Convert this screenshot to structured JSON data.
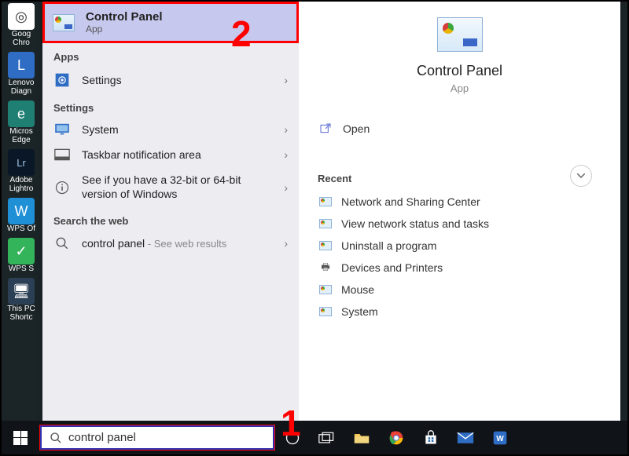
{
  "desktop": {
    "icons": [
      {
        "label": "Goog\nChro",
        "color": "#ffffff"
      },
      {
        "label": "Lenovo\nDiagn",
        "color": "#2f6dc4"
      },
      {
        "label": "Micros\nEdge",
        "color": "#1f7f73"
      },
      {
        "label": "Adobe\nLightro",
        "color": "#0a1726"
      },
      {
        "label": "WPS Of",
        "color": "#1f8fd6"
      },
      {
        "label": "WPS S",
        "color": "#33b35a"
      },
      {
        "label": "This PC\nShortc",
        "color": "#2b3f55"
      }
    ]
  },
  "best_match": {
    "title": "Control Panel",
    "subtitle": "App"
  },
  "sections": {
    "apps_head": "Apps",
    "apps": [
      {
        "icon": "gear",
        "label": "Settings"
      }
    ],
    "settings_head": "Settings",
    "settings": [
      {
        "icon": "monitor",
        "label": "System"
      },
      {
        "icon": "taskbar",
        "label": "Taskbar notification area"
      },
      {
        "icon": "info",
        "label": "See if you have a 32-bit or 64-bit version of Windows"
      }
    ],
    "web_head": "Search the web",
    "web": {
      "label": "control panel",
      "sub": " - See web results"
    }
  },
  "detail": {
    "title": "Control Panel",
    "subtitle": "App",
    "open_label": "Open",
    "recent_head": "Recent",
    "recent": [
      "Network and Sharing Center",
      "View network status and tasks",
      "Uninstall a program",
      "Devices and Printers",
      "Mouse",
      "System"
    ]
  },
  "annotations": {
    "one": "1",
    "two": "2"
  },
  "taskbar": {
    "search_value": "control panel"
  }
}
